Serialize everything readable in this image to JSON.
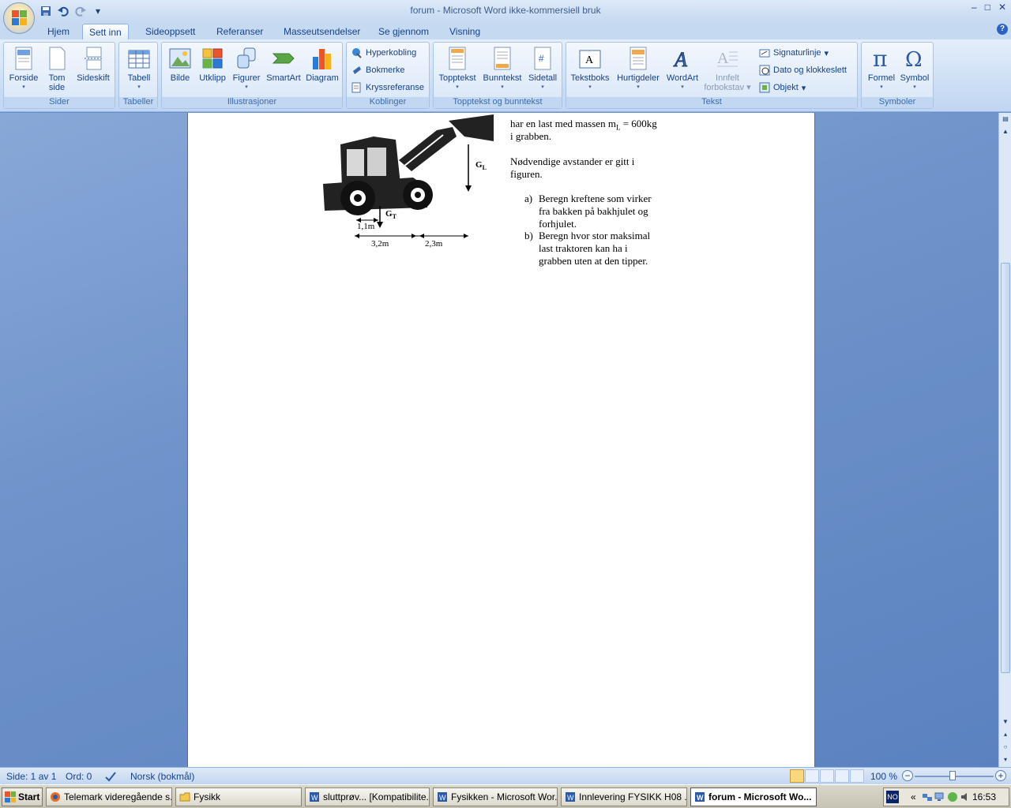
{
  "window": {
    "title": "forum - Microsoft Word ikke-kommersiell bruk",
    "min": "–",
    "max": "□",
    "close": "✕"
  },
  "qat": {
    "more": "▾"
  },
  "tabs": [
    "Hjem",
    "Sett inn",
    "Sideoppsett",
    "Referanser",
    "Masseutsendelser",
    "Se gjennom",
    "Visning"
  ],
  "ribbon": {
    "groups": {
      "sider": "Sider",
      "tabeller": "Tabeller",
      "illustrasjoner": "Illustrasjoner",
      "koblinger": "Koblinger",
      "topptekst": "Topptekst og bunntekst",
      "tekst": "Tekst",
      "symboler": "Symboler"
    },
    "buttons": {
      "forside": "Forside",
      "tom_side_1": "Tom",
      "tom_side_2": "side",
      "sideskift": "Sideskift",
      "tabell": "Tabell",
      "bilde": "Bilde",
      "utklipp": "Utklipp",
      "figurer": "Figurer",
      "smartart": "SmartArt",
      "diagram": "Diagram",
      "hyperkobling": "Hyperkobling",
      "bokmerke": "Bokmerke",
      "kryssreferanse": "Kryssreferanse",
      "topptekst": "Topptekst",
      "bunntekst": "Bunntekst",
      "sidetall": "Sidetall",
      "tekstboks": "Tekstboks",
      "hurtigdeler": "Hurtigdeler",
      "wordart": "WordArt",
      "innfelt_1": "Innfelt",
      "innfelt_2": "forbokstav",
      "signaturlinje": "Signaturlinje",
      "dato": "Dato og klokkeslett",
      "objekt": "Objekt",
      "formel": "Formel",
      "symbol": "Symbol"
    }
  },
  "document": {
    "line1_a": "har en last med massen m",
    "line1_sub": "L",
    "line1_b": " = 600kg",
    "line2": "i grabben.",
    "line3": "Nødvendige avstander er gitt i",
    "line4": "figuren.",
    "a_label": "a)",
    "a1": "Beregn kreftene som virker",
    "a2": "fra bakken på bakhjulet og",
    "a3": "forhjulet.",
    "b_label": "b)",
    "b1": "Beregn hvor stor maksimal",
    "b2": "last traktoren kan ha i",
    "b3": "grabben uten at den tipper.",
    "figure": {
      "gl": "G",
      "gl_sub": "L",
      "gt": "G",
      "gt_sub": "T",
      "d1": "1,1m",
      "d2": "3,2m",
      "d3": "2,3m"
    }
  },
  "status": {
    "page": "Side: 1 av 1",
    "words": "Ord: 0",
    "lang": "Norsk (bokmål)",
    "zoom": "100 %"
  },
  "taskbar": {
    "start": "Start",
    "tasks": [
      "Telemark videregående s...",
      "Fysikk",
      "sluttprøv... [Kompatibilite...",
      "Fysikken - Microsoft Wor...",
      "Innlevering FYSIKK H08 ...",
      "forum - Microsoft Wo..."
    ],
    "lang": "NO",
    "chevron": "«",
    "clock": "16:53"
  }
}
